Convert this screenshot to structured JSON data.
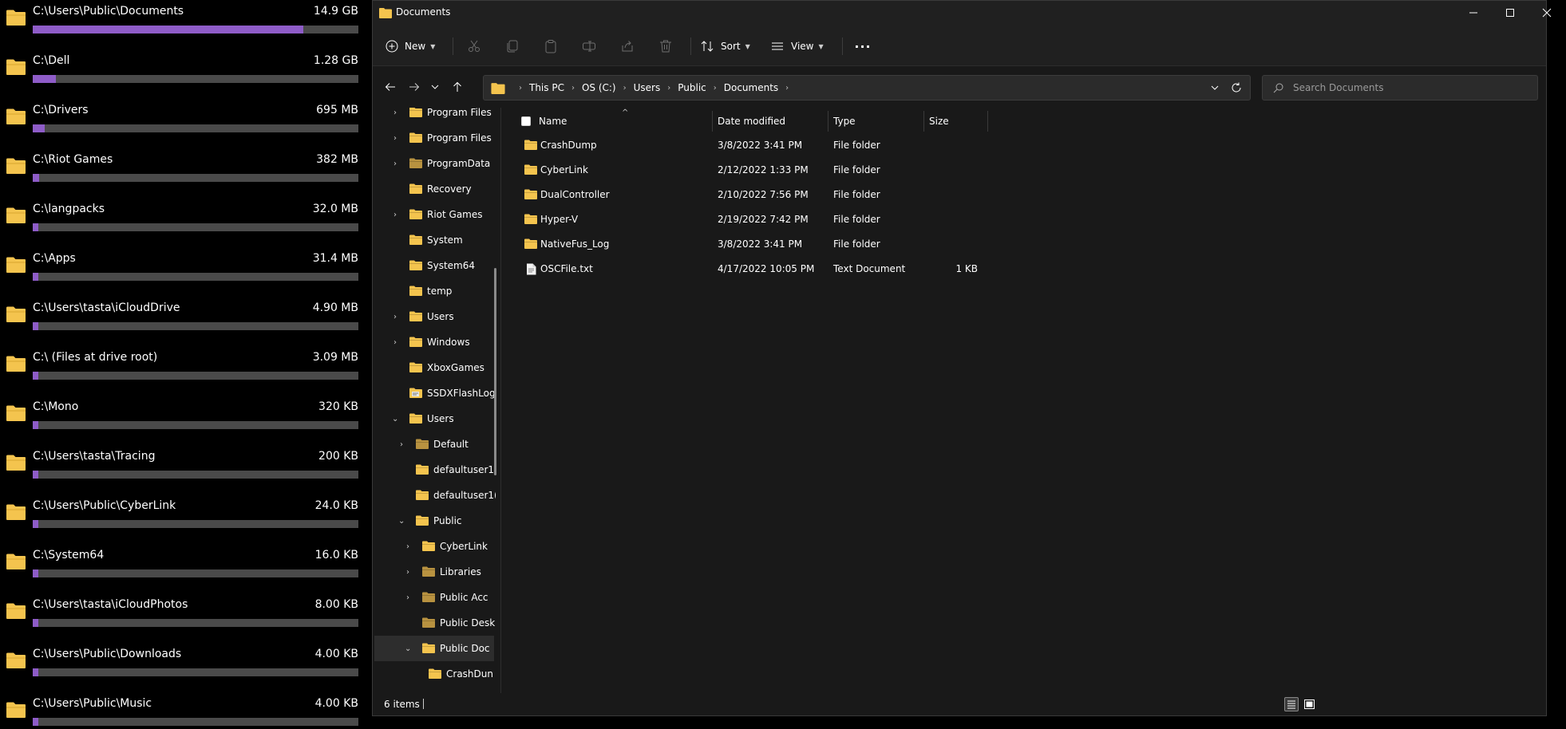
{
  "colors": {
    "accent": "#8e5cc8",
    "folder": "#f4c44e",
    "folder_dark": "#b89240",
    "bar_track": "#4a4a4a"
  },
  "disk_usage": [
    {
      "path": "C:\\Users\\Public\\Documents",
      "size": "14.9 GB",
      "fraction": 0.83
    },
    {
      "path": "C:\\Dell",
      "size": "1.28 GB",
      "fraction": 0.072
    },
    {
      "path": "C:\\Drivers",
      "size": "695 MB",
      "fraction": 0.037
    },
    {
      "path": "C:\\Riot Games",
      "size": "382 MB",
      "fraction": 0.02
    },
    {
      "path": "C:\\langpacks",
      "size": "32.0 MB",
      "fraction": 0.008
    },
    {
      "path": "C:\\Apps",
      "size": "31.4 MB",
      "fraction": 0.008
    },
    {
      "path": "C:\\Users\\tasta\\iCloudDrive",
      "size": "4.90 MB",
      "fraction": 0.006
    },
    {
      "path": "C:\\ (Files at drive root)",
      "size": "3.09 MB",
      "fraction": 0.006
    },
    {
      "path": "C:\\Mono",
      "size": "320 KB",
      "fraction": 0.006
    },
    {
      "path": "C:\\Users\\tasta\\Tracing",
      "size": "200 KB",
      "fraction": 0.006
    },
    {
      "path": "C:\\Users\\Public\\CyberLink",
      "size": "24.0 KB",
      "fraction": 0.006
    },
    {
      "path": "C:\\System64",
      "size": "16.0 KB",
      "fraction": 0.006
    },
    {
      "path": "C:\\Users\\tasta\\iCloudPhotos",
      "size": "8.00 KB",
      "fraction": 0.006
    },
    {
      "path": "C:\\Users\\Public\\Downloads",
      "size": "4.00 KB",
      "fraction": 0.006
    },
    {
      "path": "C:\\Users\\Public\\Music",
      "size": "4.00 KB",
      "fraction": 0.006
    }
  ],
  "window": {
    "title": "Documents"
  },
  "toolbar": {
    "new_label": "New",
    "sort_label": "Sort",
    "view_label": "View",
    "more_label": "···"
  },
  "address": {
    "crumbs": [
      "This PC",
      "OS (C:)",
      "Users",
      "Public",
      "Documents"
    ]
  },
  "search": {
    "placeholder": "Search Documents"
  },
  "nav_tree": [
    {
      "label": "Program Files",
      "level": 1,
      "expand": "collapsed",
      "icon": "folder"
    },
    {
      "label": "Program Files",
      "level": 1,
      "expand": "collapsed",
      "icon": "folder"
    },
    {
      "label": "ProgramData",
      "level": 1,
      "expand": "collapsed",
      "icon": "folder-dark"
    },
    {
      "label": "Recovery",
      "level": 1,
      "expand": "none",
      "icon": "folder"
    },
    {
      "label": "Riot Games",
      "level": 1,
      "expand": "collapsed",
      "icon": "folder"
    },
    {
      "label": "System",
      "level": 1,
      "expand": "none",
      "icon": "folder"
    },
    {
      "label": "System64",
      "level": 1,
      "expand": "none",
      "icon": "folder"
    },
    {
      "label": "temp",
      "level": 1,
      "expand": "none",
      "icon": "folder"
    },
    {
      "label": "Users",
      "level": 1,
      "expand": "collapsed",
      "icon": "folder"
    },
    {
      "label": "Windows",
      "level": 1,
      "expand": "collapsed",
      "icon": "folder"
    },
    {
      "label": "XboxGames",
      "level": 1,
      "expand": "none",
      "icon": "folder"
    },
    {
      "label": "SSDXFlashLog",
      "level": 1,
      "expand": "none",
      "icon": "folder-file"
    },
    {
      "label": "Users",
      "level": 1,
      "expand": "expanded",
      "icon": "folder"
    },
    {
      "label": "Default",
      "level": 2,
      "expand": "collapsed",
      "icon": "folder-dark"
    },
    {
      "label": "defaultuser1(",
      "level": 2,
      "expand": "none",
      "icon": "folder"
    },
    {
      "label": "defaultuser1(",
      "level": 2,
      "expand": "none",
      "icon": "folder"
    },
    {
      "label": "Public",
      "level": 2,
      "expand": "expanded",
      "icon": "folder"
    },
    {
      "label": "CyberLink",
      "level": 3,
      "expand": "collapsed",
      "icon": "folder"
    },
    {
      "label": "Libraries",
      "level": 3,
      "expand": "collapsed",
      "icon": "folder-dark"
    },
    {
      "label": "Public Acc",
      "level": 3,
      "expand": "collapsed",
      "icon": "folder-dark"
    },
    {
      "label": "Public Desk",
      "level": 3,
      "expand": "none",
      "icon": "folder-dark"
    },
    {
      "label": "Public Doc",
      "level": 3,
      "expand": "expanded",
      "icon": "folder",
      "selected": true
    },
    {
      "label": "CrashDun",
      "level": 4,
      "expand": "none",
      "icon": "folder"
    }
  ],
  "columns": {
    "name": "Name",
    "date": "Date modified",
    "type": "Type",
    "size": "Size"
  },
  "files": [
    {
      "name": "CrashDump",
      "date": "3/8/2022 3:41 PM",
      "type": "File folder",
      "size": "",
      "icon": "folder"
    },
    {
      "name": "CyberLink",
      "date": "2/12/2022 1:33 PM",
      "type": "File folder",
      "size": "",
      "icon": "folder"
    },
    {
      "name": "DualController",
      "date": "2/10/2022 7:56 PM",
      "type": "File folder",
      "size": "",
      "icon": "folder"
    },
    {
      "name": "Hyper-V",
      "date": "2/19/2022 7:42 PM",
      "type": "File folder",
      "size": "",
      "icon": "folder"
    },
    {
      "name": "NativeFus_Log",
      "date": "3/8/2022 3:41 PM",
      "type": "File folder",
      "size": "",
      "icon": "folder"
    },
    {
      "name": "OSCFile.txt",
      "date": "4/17/2022 10:05 PM",
      "type": "Text Document",
      "size": "1 KB",
      "icon": "text-file"
    }
  ],
  "status": {
    "item_count": "6 items"
  }
}
